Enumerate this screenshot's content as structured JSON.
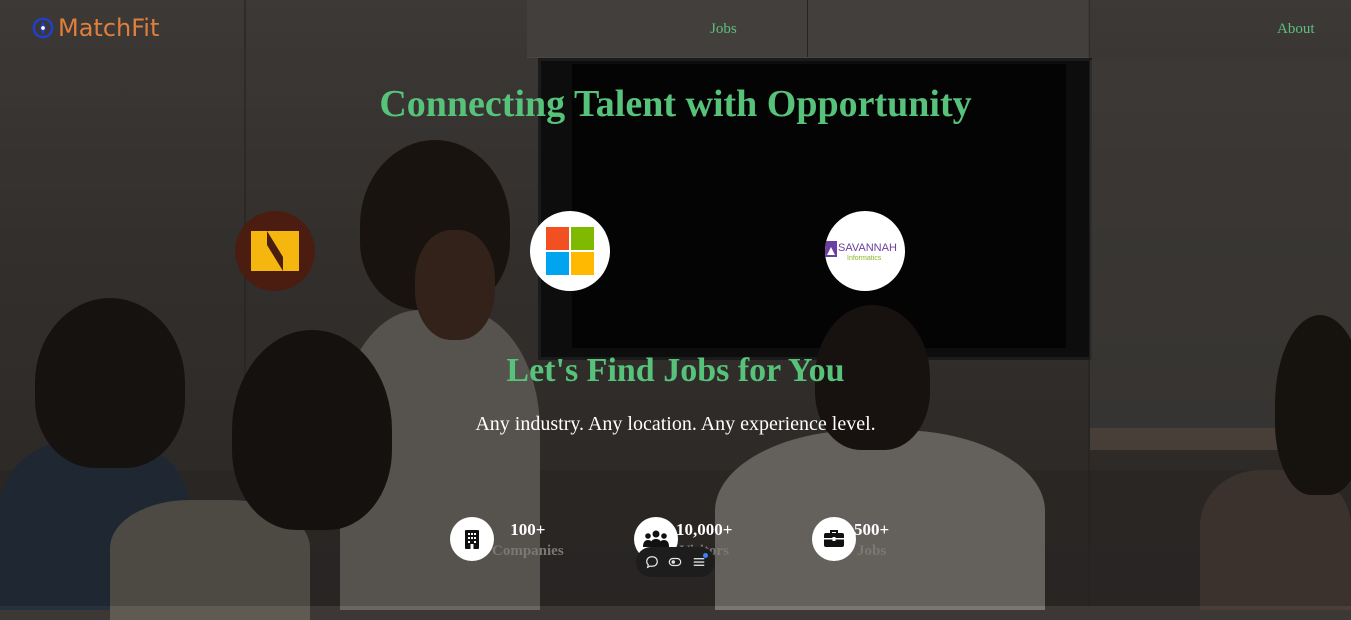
{
  "brand": {
    "name": "MatchFit",
    "icon": "compass-icon"
  },
  "nav": {
    "jobs": "Jobs",
    "about": "About"
  },
  "hero": {
    "title": "Connecting Talent with Opportunity",
    "subtitle": "Let's Find Jobs for You",
    "tagline": "Any industry. Any location. Any experience level."
  },
  "partners": [
    {
      "name": "N-logo",
      "icon": "stylized-n-logo"
    },
    {
      "name": "Microsoft",
      "icon": "microsoft-logo"
    },
    {
      "name": "SAVANNAH",
      "sub": "Informatics",
      "icon": "savannah-informatics-logo"
    }
  ],
  "stats": [
    {
      "value": "100+",
      "label": "Companies",
      "icon": "building-icon"
    },
    {
      "value": "10,000+",
      "label": "Visitors",
      "icon": "people-icon"
    },
    {
      "value": "500+",
      "label": "Jobs",
      "icon": "briefcase-icon"
    }
  ],
  "toolbar": {
    "icons": [
      "comment-icon",
      "toggle-icon",
      "menu-icon"
    ]
  },
  "colors": {
    "accent": "#56c27a",
    "brand": "#e07f3c",
    "brand_icon": "#1f3fd6"
  }
}
